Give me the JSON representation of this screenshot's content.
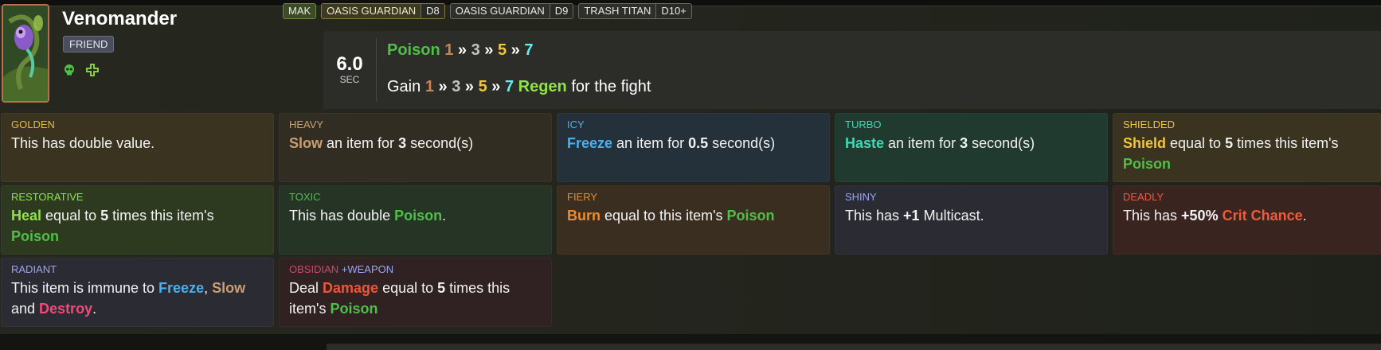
{
  "item": {
    "name": "Venomander",
    "badge": "FRIEND",
    "icons": [
      "skull-icon",
      "plus-icon"
    ]
  },
  "tags": [
    {
      "label": "MAK"
    },
    {
      "label": "OASIS GUARDIAN",
      "level": "D8"
    },
    {
      "label": "OASIS GUARDIAN",
      "level": "D9"
    },
    {
      "label": "TRASH TITAN",
      "level": "D10+"
    }
  ],
  "ability": {
    "cooldown": "6.0",
    "cooldown_unit": "SEC",
    "line1": {
      "keyword": "Poison",
      "tiers": [
        "1",
        "3",
        "5",
        "7"
      ],
      "sep": "»"
    },
    "line2": {
      "prefix": "Gain",
      "tiers": [
        "1",
        "3",
        "5",
        "7"
      ],
      "keyword": "Regen",
      "suffix": "for the fight"
    }
  },
  "enchantments": {
    "golden": {
      "name": "GOLDEN",
      "text": "This has double value.",
      "name_color": "#e8b93a",
      "bg": "#3a331f"
    },
    "heavy": {
      "name": "HEAVY",
      "t1": "Slow",
      "t2": " an item for ",
      "t3": "3",
      "t4": " second(s)",
      "name_color": "#c9a073",
      "bg": "#322d22"
    },
    "icy": {
      "name": "ICY",
      "t1": "Freeze",
      "t2": " an item for ",
      "t3": "0.5",
      "t4": " second(s)",
      "name_color": "#4ab0ef",
      "bg": "#24313a"
    },
    "turbo": {
      "name": "TURBO",
      "t1": "Haste",
      "t2": " an item for ",
      "t3": "3",
      "t4": " second(s)",
      "name_color": "#3fd9b4",
      "bg": "#203a2f"
    },
    "shielded": {
      "name": "SHIELDED",
      "t1": "Shield",
      "t2": " equal to ",
      "t3": "5",
      "t4": " times this item's ",
      "t5": "Poison",
      "name_color": "#f2c53a",
      "bg": "#3a3320"
    },
    "restorative": {
      "name": "RESTORATIVE",
      "t1": "Heal",
      "t2": " equal to ",
      "t3": "5",
      "t4": " times this item's ",
      "t5": "Poison",
      "name_color": "#8fe24a",
      "bg": "#2d3a20"
    },
    "toxic": {
      "name": "TOXIC",
      "t1": "This has double ",
      "t2": "Poison",
      "t3": ".",
      "name_color": "#4fbf4a",
      "bg": "#263425"
    },
    "fiery": {
      "name": "FIERY",
      "t1": "Burn",
      "t2": " equal to this item's ",
      "t3": "Poison",
      "name_color": "#f08a2a",
      "bg": "#3a2e20"
    },
    "shiny": {
      "name": "SHINY",
      "t1": "This has ",
      "t2": "+1",
      "t3": " Multicast.",
      "name_color": "#9aa5f5",
      "bg": "#2a2b33"
    },
    "deadly": {
      "name": "DEADLY",
      "t1": "This has ",
      "t2": "+50%",
      "t3": " ",
      "t4": "Crit Chance",
      "t5": ".",
      "name_color": "#f05a3a",
      "bg": "#3a2420"
    },
    "radiant": {
      "name": "RADIANT",
      "t1": "This item is immune to ",
      "t2": "Freeze",
      "t3": ", ",
      "t4": "Slow",
      "t5": " and ",
      "t6": "Destroy",
      "t7": ".",
      "name_color": "#9aa5f5",
      "bg": "#2a2b33"
    },
    "obsidian": {
      "name": "OBSIDIAN",
      "extra": "+WEAPON",
      "t1": "Deal ",
      "t2": "Damage",
      "t3": " equal to ",
      "t4": "5",
      "t5": " times this item's ",
      "t6": "Poison",
      "name_color": "#c84a6a",
      "extra_color": "#9aa5f5",
      "bg": "#302222"
    }
  }
}
